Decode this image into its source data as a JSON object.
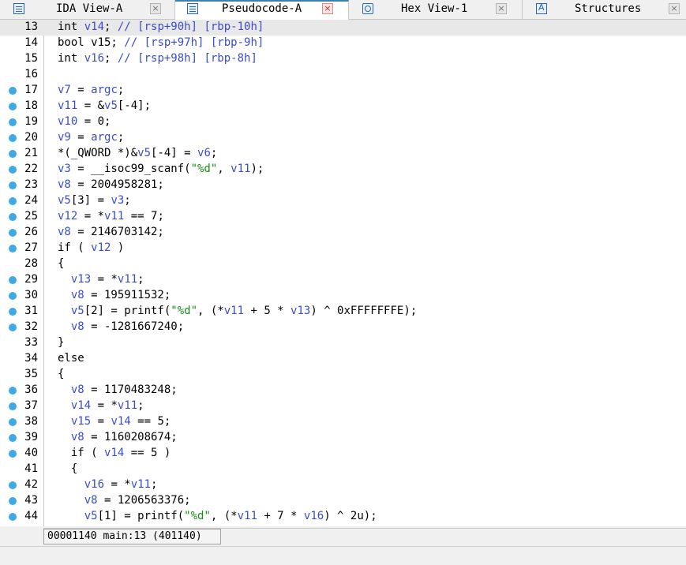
{
  "tabs": [
    {
      "label": "IDA View-A",
      "icon": "lines-icon",
      "active": false,
      "close": "×"
    },
    {
      "label": "Pseudocode-A",
      "icon": "pseudocode-icon",
      "active": true,
      "close": "×"
    },
    {
      "label": "Hex View-1",
      "icon": "hex-icon",
      "active": false,
      "close": "×"
    },
    {
      "label": "Structures",
      "icon": "struct-icon",
      "active": false,
      "close": "×"
    }
  ],
  "colors": {
    "variable": "#3a4cc8",
    "string": "#1b8a1b",
    "breakpoint": "#3fa9e8",
    "current_line": "#e8e8e8"
  },
  "lines": [
    {
      "n": "13",
      "bp": false,
      "current": true,
      "tokens": [
        [
          "p",
          "int "
        ],
        [
          "v",
          "v14"
        ],
        [
          "p",
          "; "
        ],
        [
          "c",
          "// [rsp+90h] [rbp-10h]"
        ]
      ]
    },
    {
      "n": "14",
      "bp": false,
      "current": false,
      "tokens": [
        [
          "p",
          "bool v15; "
        ],
        [
          "c",
          "// [rsp+97h] [rbp-9h]"
        ]
      ]
    },
    {
      "n": "15",
      "bp": false,
      "current": false,
      "tokens": [
        [
          "p",
          "int "
        ],
        [
          "v",
          "v16"
        ],
        [
          "p",
          "; "
        ],
        [
          "c",
          "// [rsp+98h] [rbp-8h]"
        ]
      ]
    },
    {
      "n": "16",
      "bp": false,
      "current": false,
      "tokens": []
    },
    {
      "n": "17",
      "bp": true,
      "current": false,
      "tokens": [
        [
          "v",
          "v7"
        ],
        [
          "p",
          " = "
        ],
        [
          "v",
          "argc"
        ],
        [
          "p",
          ";"
        ]
      ]
    },
    {
      "n": "18",
      "bp": true,
      "current": false,
      "tokens": [
        [
          "v",
          "v11"
        ],
        [
          "p",
          " = &"
        ],
        [
          "v",
          "v5"
        ],
        [
          "p",
          "[-4];"
        ]
      ]
    },
    {
      "n": "19",
      "bp": true,
      "current": false,
      "tokens": [
        [
          "v",
          "v10"
        ],
        [
          "p",
          " = 0;"
        ]
      ]
    },
    {
      "n": "20",
      "bp": true,
      "current": false,
      "tokens": [
        [
          "v",
          "v9"
        ],
        [
          "p",
          " = "
        ],
        [
          "v",
          "argc"
        ],
        [
          "p",
          ";"
        ]
      ]
    },
    {
      "n": "21",
      "bp": true,
      "current": false,
      "tokens": [
        [
          "p",
          "*(_QWORD *)&"
        ],
        [
          "v",
          "v5"
        ],
        [
          "p",
          "[-4] = "
        ],
        [
          "v",
          "v6"
        ],
        [
          "p",
          ";"
        ]
      ]
    },
    {
      "n": "22",
      "bp": true,
      "current": false,
      "tokens": [
        [
          "v",
          "v3"
        ],
        [
          "p",
          " = __isoc99_scanf("
        ],
        [
          "s",
          "\"%d\""
        ],
        [
          "p",
          ", "
        ],
        [
          "v",
          "v11"
        ],
        [
          "p",
          ");"
        ]
      ]
    },
    {
      "n": "23",
      "bp": true,
      "current": false,
      "tokens": [
        [
          "v",
          "v8"
        ],
        [
          "p",
          " = 2004958281;"
        ]
      ]
    },
    {
      "n": "24",
      "bp": true,
      "current": false,
      "tokens": [
        [
          "v",
          "v5"
        ],
        [
          "p",
          "[3] = "
        ],
        [
          "v",
          "v3"
        ],
        [
          "p",
          ";"
        ]
      ]
    },
    {
      "n": "25",
      "bp": true,
      "current": false,
      "tokens": [
        [
          "v",
          "v12"
        ],
        [
          "p",
          " = *"
        ],
        [
          "v",
          "v11"
        ],
        [
          "p",
          " == 7;"
        ]
      ]
    },
    {
      "n": "26",
      "bp": true,
      "current": false,
      "tokens": [
        [
          "v",
          "v8"
        ],
        [
          "p",
          " = 2146703142;"
        ]
      ]
    },
    {
      "n": "27",
      "bp": true,
      "current": false,
      "tokens": [
        [
          "p",
          "if ( "
        ],
        [
          "v",
          "v12"
        ],
        [
          "p",
          " )"
        ]
      ]
    },
    {
      "n": "28",
      "bp": false,
      "current": false,
      "tokens": [
        [
          "p",
          "{"
        ]
      ]
    },
    {
      "n": "29",
      "bp": true,
      "current": false,
      "tokens": [
        [
          "p",
          "  "
        ],
        [
          "v",
          "v13"
        ],
        [
          "p",
          " = *"
        ],
        [
          "v",
          "v11"
        ],
        [
          "p",
          ";"
        ]
      ]
    },
    {
      "n": "30",
      "bp": true,
      "current": false,
      "tokens": [
        [
          "p",
          "  "
        ],
        [
          "v",
          "v8"
        ],
        [
          "p",
          " = 195911532;"
        ]
      ]
    },
    {
      "n": "31",
      "bp": true,
      "current": false,
      "tokens": [
        [
          "p",
          "  "
        ],
        [
          "v",
          "v5"
        ],
        [
          "p",
          "[2] = printf("
        ],
        [
          "s",
          "\"%d\""
        ],
        [
          "p",
          ", (*"
        ],
        [
          "v",
          "v11"
        ],
        [
          "p",
          " + 5 * "
        ],
        [
          "v",
          "v13"
        ],
        [
          "p",
          ") ^ 0xFFFFFFFE);"
        ]
      ]
    },
    {
      "n": "32",
      "bp": true,
      "current": false,
      "tokens": [
        [
          "p",
          "  "
        ],
        [
          "v",
          "v8"
        ],
        [
          "p",
          " = -1281667240;"
        ]
      ]
    },
    {
      "n": "33",
      "bp": false,
      "current": false,
      "tokens": [
        [
          "p",
          "}"
        ]
      ]
    },
    {
      "n": "34",
      "bp": false,
      "current": false,
      "tokens": [
        [
          "p",
          "else"
        ]
      ]
    },
    {
      "n": "35",
      "bp": false,
      "current": false,
      "tokens": [
        [
          "p",
          "{"
        ]
      ]
    },
    {
      "n": "36",
      "bp": true,
      "current": false,
      "tokens": [
        [
          "p",
          "  "
        ],
        [
          "v",
          "v8"
        ],
        [
          "p",
          " = 1170483248;"
        ]
      ]
    },
    {
      "n": "37",
      "bp": true,
      "current": false,
      "tokens": [
        [
          "p",
          "  "
        ],
        [
          "v",
          "v14"
        ],
        [
          "p",
          " = *"
        ],
        [
          "v",
          "v11"
        ],
        [
          "p",
          ";"
        ]
      ]
    },
    {
      "n": "38",
      "bp": true,
      "current": false,
      "tokens": [
        [
          "p",
          "  "
        ],
        [
          "v",
          "v15"
        ],
        [
          "p",
          " = "
        ],
        [
          "v",
          "v14"
        ],
        [
          "p",
          " == 5;"
        ]
      ]
    },
    {
      "n": "39",
      "bp": true,
      "current": false,
      "tokens": [
        [
          "p",
          "  "
        ],
        [
          "v",
          "v8"
        ],
        [
          "p",
          " = 1160208674;"
        ]
      ]
    },
    {
      "n": "40",
      "bp": true,
      "current": false,
      "tokens": [
        [
          "p",
          "  if ( "
        ],
        [
          "v",
          "v14"
        ],
        [
          "p",
          " == 5 )"
        ]
      ]
    },
    {
      "n": "41",
      "bp": false,
      "current": false,
      "tokens": [
        [
          "p",
          "  {"
        ]
      ]
    },
    {
      "n": "42",
      "bp": true,
      "current": false,
      "tokens": [
        [
          "p",
          "    "
        ],
        [
          "v",
          "v16"
        ],
        [
          "p",
          " = *"
        ],
        [
          "v",
          "v11"
        ],
        [
          "p",
          ";"
        ]
      ]
    },
    {
      "n": "43",
      "bp": true,
      "current": false,
      "tokens": [
        [
          "p",
          "    "
        ],
        [
          "v",
          "v8"
        ],
        [
          "p",
          " = 1206563376;"
        ]
      ]
    },
    {
      "n": "44",
      "bp": true,
      "current": false,
      "tokens": [
        [
          "p",
          "    "
        ],
        [
          "v",
          "v5"
        ],
        [
          "p",
          "[1] = printf("
        ],
        [
          "s",
          "\"%d\""
        ],
        [
          "p",
          ", (*"
        ],
        [
          "v",
          "v11"
        ],
        [
          "p",
          " + 7 * "
        ],
        [
          "v",
          "v16"
        ],
        [
          "p",
          ") ^ 2u);"
        ]
      ]
    }
  ],
  "status": {
    "text": "00001140 main:13 (401140)"
  }
}
